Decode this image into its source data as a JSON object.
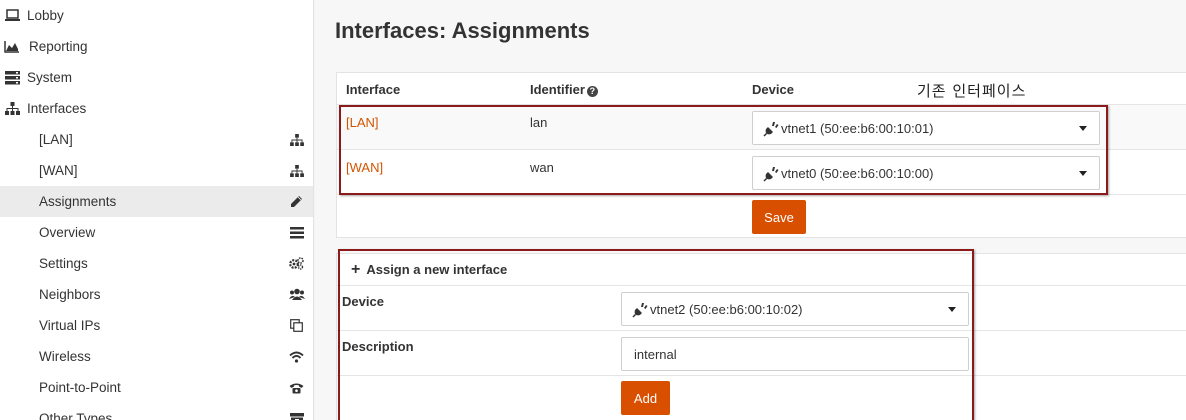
{
  "sidebar": {
    "top_items": [
      {
        "label": "Lobby",
        "icon": "laptop-icon"
      },
      {
        "label": "Reporting",
        "icon": "area-chart-icon"
      },
      {
        "label": "System",
        "icon": "server-icon"
      },
      {
        "label": "Interfaces",
        "icon": "sitemap-icon"
      }
    ],
    "sub_items": [
      {
        "label": "[LAN]",
        "icon": "sitemap-icon"
      },
      {
        "label": "[WAN]",
        "icon": "sitemap-icon"
      },
      {
        "label": "Assignments",
        "icon": "pencil-icon"
      },
      {
        "label": "Overview",
        "icon": "list-icon"
      },
      {
        "label": "Settings",
        "icon": "cogs-icon"
      },
      {
        "label": "Neighbors",
        "icon": "users-icon"
      },
      {
        "label": "Virtual IPs",
        "icon": "clone-icon"
      },
      {
        "label": "Wireless",
        "icon": "wifi-icon"
      },
      {
        "label": "Point-to-Point",
        "icon": "phone-icon"
      },
      {
        "label": "Other Types",
        "icon": "archive-icon"
      }
    ],
    "active_item": "Assignments"
  },
  "page": {
    "title": "Interfaces: Assignments"
  },
  "assignments_table": {
    "headers": {
      "interface": "Interface",
      "identifier": "Identifier",
      "device": "Device"
    },
    "annotation_note": "기존  인터페이스",
    "rows": [
      {
        "interface": "[LAN]",
        "identifier": "lan",
        "device": "vtnet1 (50:ee:b6:00:10:01)"
      },
      {
        "interface": "[WAN]",
        "identifier": "wan",
        "device": "vtnet0 (50:ee:b6:00:10:00)"
      }
    ],
    "save_label": "Save"
  },
  "assign_new": {
    "heading": "Assign a new interface",
    "device_label": "Device",
    "device_value": "vtnet2 (50:ee:b6:00:10:02)",
    "description_label": "Description",
    "description_value": "internal",
    "add_label": "Add"
  },
  "colors": {
    "accent": "#d94f00",
    "link": "#d35400",
    "annotation_border": "#8b1a1a",
    "active_bg": "#ebebeb"
  }
}
